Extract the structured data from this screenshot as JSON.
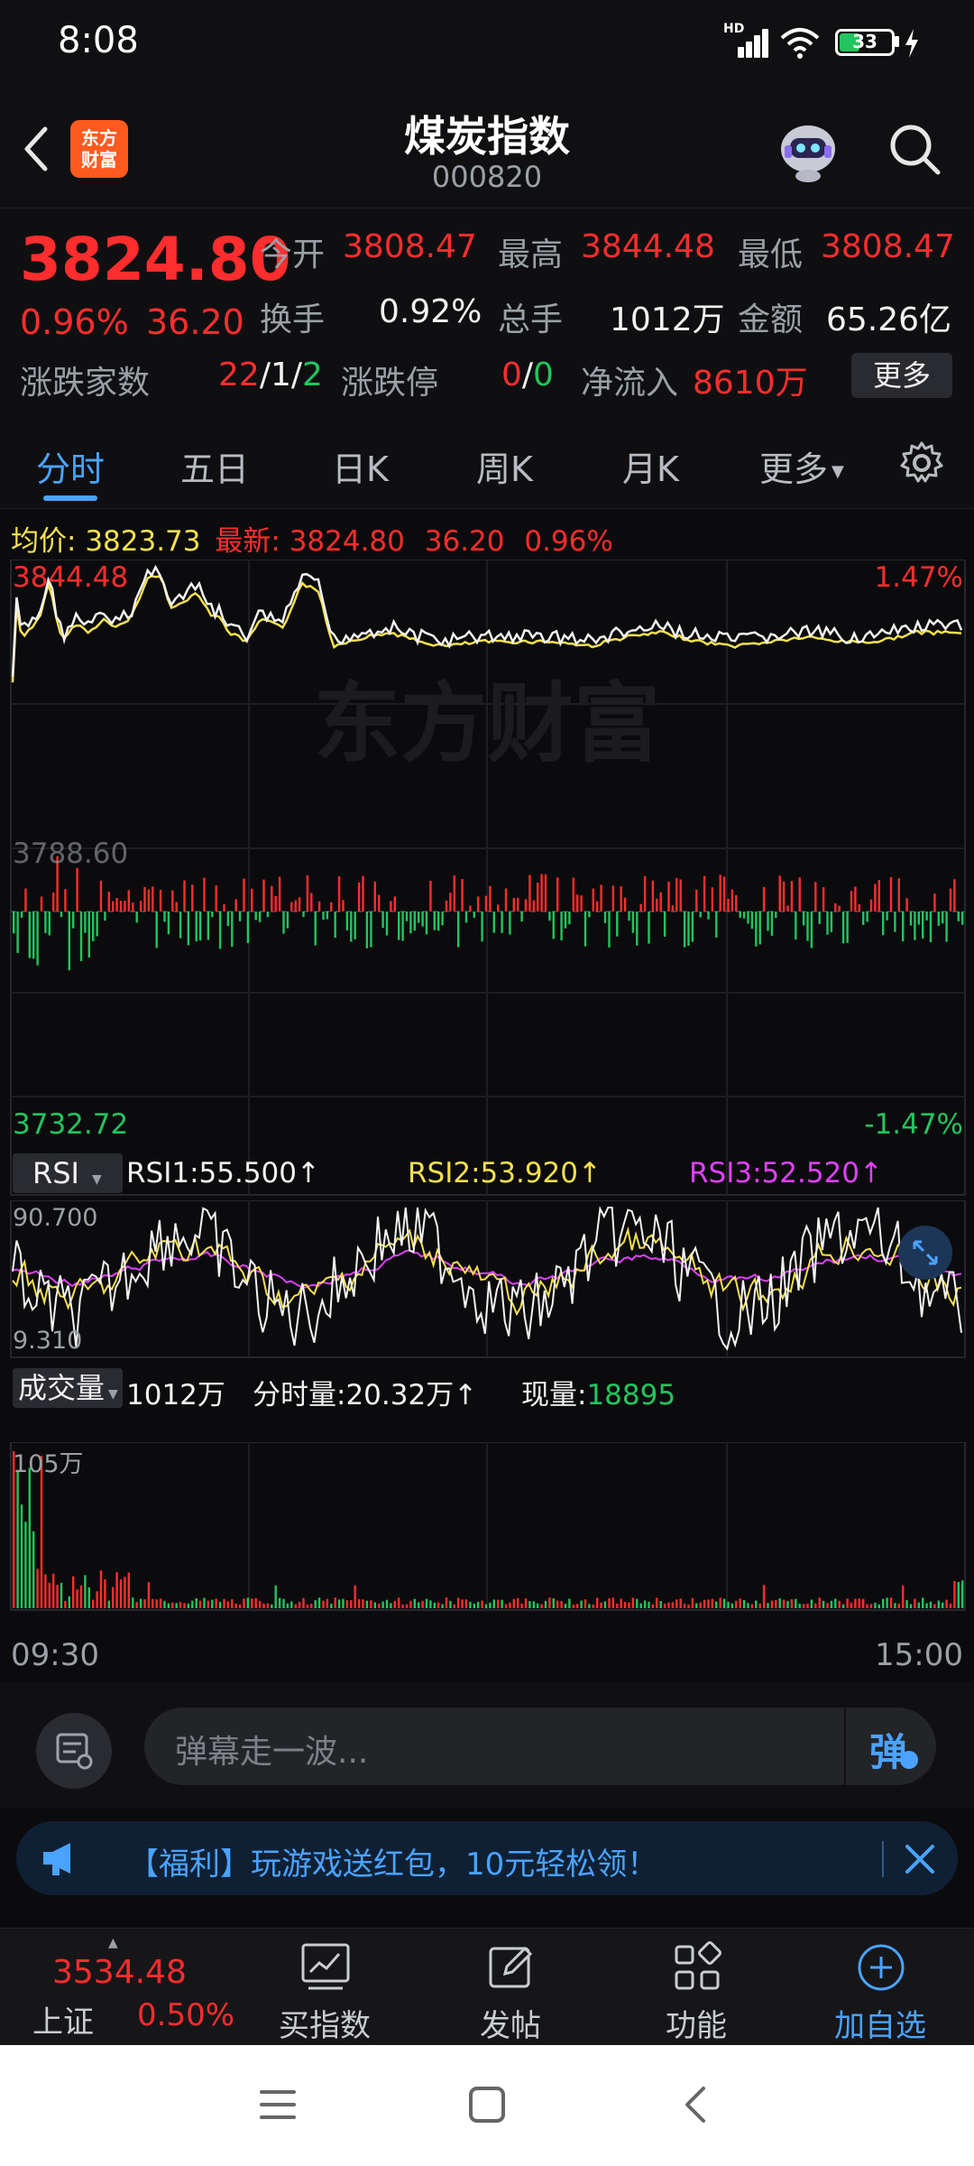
{
  "status_bar": {
    "time": "8:08",
    "network": "HD",
    "battery": "33"
  },
  "header": {
    "title": "煤炭指数",
    "code": "000820",
    "logo_text_1": "东方",
    "logo_text_2": "财富"
  },
  "quote": {
    "price": "3824.80",
    "change_pct": "0.96%",
    "change_amt": "36.20",
    "open_label": "今开",
    "open": "3808.47",
    "high_label": "最高",
    "high": "3844.48",
    "low_label": "最低",
    "low": "3808.47",
    "turnover_label": "换手",
    "turnover": "0.92%",
    "volume_label": "总手",
    "volume": "1012万",
    "amount_label": "金额",
    "amount": "65.26亿",
    "adv_dec_label": "涨跌家数",
    "adv": "22",
    "flat": "1",
    "dec": "2",
    "limit_label": "涨跌停",
    "limit_up": "0",
    "limit_down": "0",
    "netflow_label": "净流入",
    "netflow": "8610万",
    "more_button": "更多"
  },
  "tabs": [
    "分时",
    "五日",
    "日K",
    "周K",
    "月K",
    "更多"
  ],
  "intraday": {
    "avg_label": "均价:",
    "avg": "3823.73",
    "last_label": "最新:",
    "last": "3824.80",
    "last_chg": "36.20",
    "last_pct": "0.96%",
    "top_price": "3844.48",
    "top_pct": "1.47%",
    "mid_price": "3788.60",
    "bottom_price": "3732.72",
    "bottom_pct": "-1.47%"
  },
  "rsi": {
    "selector": "RSI",
    "rsi1": "RSI1:55.500↑",
    "rsi2": "RSI2:53.920↑",
    "rsi3": "RSI3:52.520↑",
    "max": "90.700",
    "min": "9.310"
  },
  "volume_panel": {
    "selector": "成交量",
    "total": "1012万",
    "minute_vol": "分时量:20.32万↑",
    "current_label": "现量:",
    "current": "18895",
    "max": "105万",
    "time_start": "09:30",
    "time_end": "15:00"
  },
  "comment": {
    "placeholder": "弹幕走一波...",
    "button": "弹"
  },
  "promo": {
    "text": "【福利】玩游戏送红包，10元轻松领！"
  },
  "bottom_nav": {
    "index_value": "3534.48",
    "index_name": "上证",
    "index_pct": "0.50%",
    "buy_index": "买指数",
    "post": "发帖",
    "features": "功能",
    "add_watch": "加自选"
  },
  "watermark": "东方财富",
  "colors": {
    "up": "#ff2d2d",
    "down": "#22c55e",
    "accent": "#4aa3ff",
    "avg_line": "#f4e04d"
  }
}
